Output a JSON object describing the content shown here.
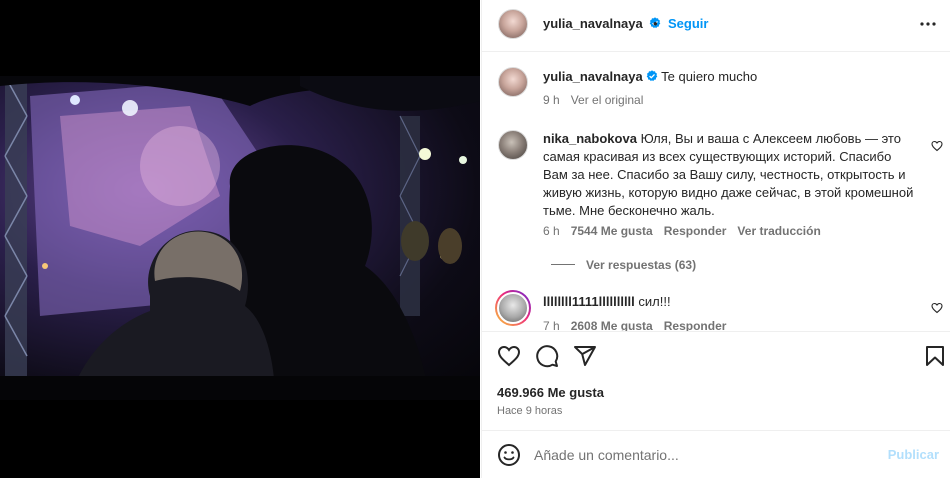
{
  "post_header": {
    "username": "yulia_navalnaya",
    "separator": "•",
    "follow_label": "Seguir",
    "more_icon": "more-horizontal-icon"
  },
  "caption": {
    "username": "yulia_navalnaya",
    "text": "Te quiero mucho",
    "time": "9 h",
    "see_original": "Ver el original"
  },
  "comments": [
    {
      "username": "nika_nabokova",
      "text": "Юля, Вы и ваша с Алексеем любовь — это самая красивая из всех существующих историй. Спасибо Вам за нее. Спасибо за Вашу силу, честность, открытость и живую жизнь, которую видно даже сейчас, в этой кромешной тьме. Мне бесконечно жаль.",
      "time": "6 h",
      "likes": "7544 Me gusta",
      "reply": "Responder",
      "translate": "Ver traducción",
      "view_replies": "Ver respuestas (63)"
    },
    {
      "username": "llllllll1111llllllllll",
      "text": "сил!!!",
      "time": "7 h",
      "likes": "2608 Me gusta",
      "reply": "Responder"
    }
  ],
  "actions": {
    "icons": [
      "heart-icon",
      "comment-icon",
      "share-icon",
      "bookmark-icon"
    ],
    "likes_count": "469.966 Me gusta",
    "posted_ago": "Hace 9 horas"
  },
  "add_comment": {
    "placeholder": "Añade un comentario...",
    "publish_label": "Publicar"
  },
  "colors": {
    "accent": "#0095f6",
    "verified": "#0095f6",
    "publish_disabled": "#b2dffc",
    "secondary_text": "#737373"
  }
}
